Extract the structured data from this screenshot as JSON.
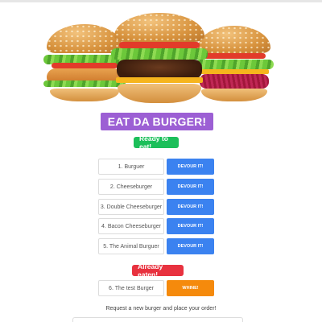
{
  "header": {
    "title": "EAT DA BURGER!"
  },
  "ready": {
    "badge": "Ready to eat!",
    "items": [
      {
        "name": "1. Burguer",
        "action": "DEVOUR IT!"
      },
      {
        "name": "2. Cheeseburger",
        "action": "DEVOUR IT!"
      },
      {
        "name": "3. Double Cheeseburger",
        "action": "DEVOUR IT!"
      },
      {
        "name": "4. Bacon Cheeseburger",
        "action": "DEVOUR IT!"
      },
      {
        "name": "5. The Animal Burguer",
        "action": "DEVOUR IT!"
      }
    ]
  },
  "eaten": {
    "badge": "Already eaten!",
    "items": [
      {
        "name": "6. The test Burger",
        "action": "WHINE!"
      }
    ]
  },
  "form": {
    "prompt": "Request a new burger and place your order!"
  },
  "colors": {
    "title_bg": "#9c5fd4",
    "ready_badge": "#1cbf5a",
    "eaten_badge": "#e8323f",
    "devour_button": "#3b82f0",
    "whine_button": "#f58a0c"
  }
}
